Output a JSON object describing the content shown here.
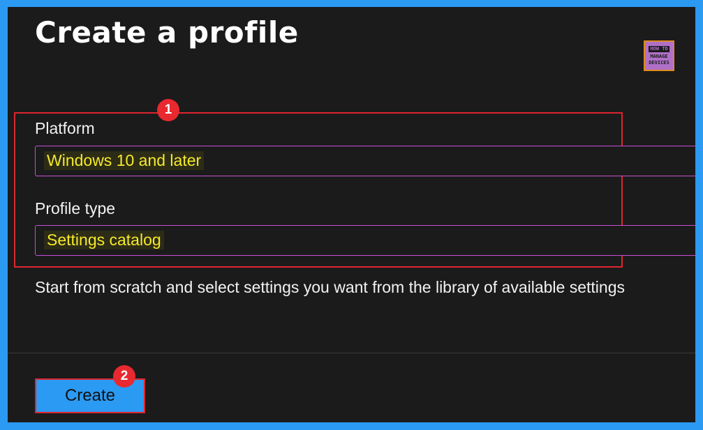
{
  "page": {
    "title": "Create a profile"
  },
  "logo": {
    "line1": "HOW TO",
    "line2": "MANAGE",
    "line3": "DEVICES"
  },
  "form": {
    "platform": {
      "label": "Platform",
      "value": "Windows 10 and later"
    },
    "profile_type": {
      "label": "Profile type",
      "value": "Settings catalog"
    },
    "description": "Start from scratch and select settings you want from the library of available settings"
  },
  "annotations": {
    "step1": "1",
    "step2": "2"
  },
  "footer": {
    "create_label": "Create"
  },
  "colors": {
    "background": "#1b1b1b",
    "frame": "#2b9af3",
    "value_text": "#f5ea2a",
    "select_border": "#c94fd6",
    "annotation_red": "#e0252f"
  }
}
